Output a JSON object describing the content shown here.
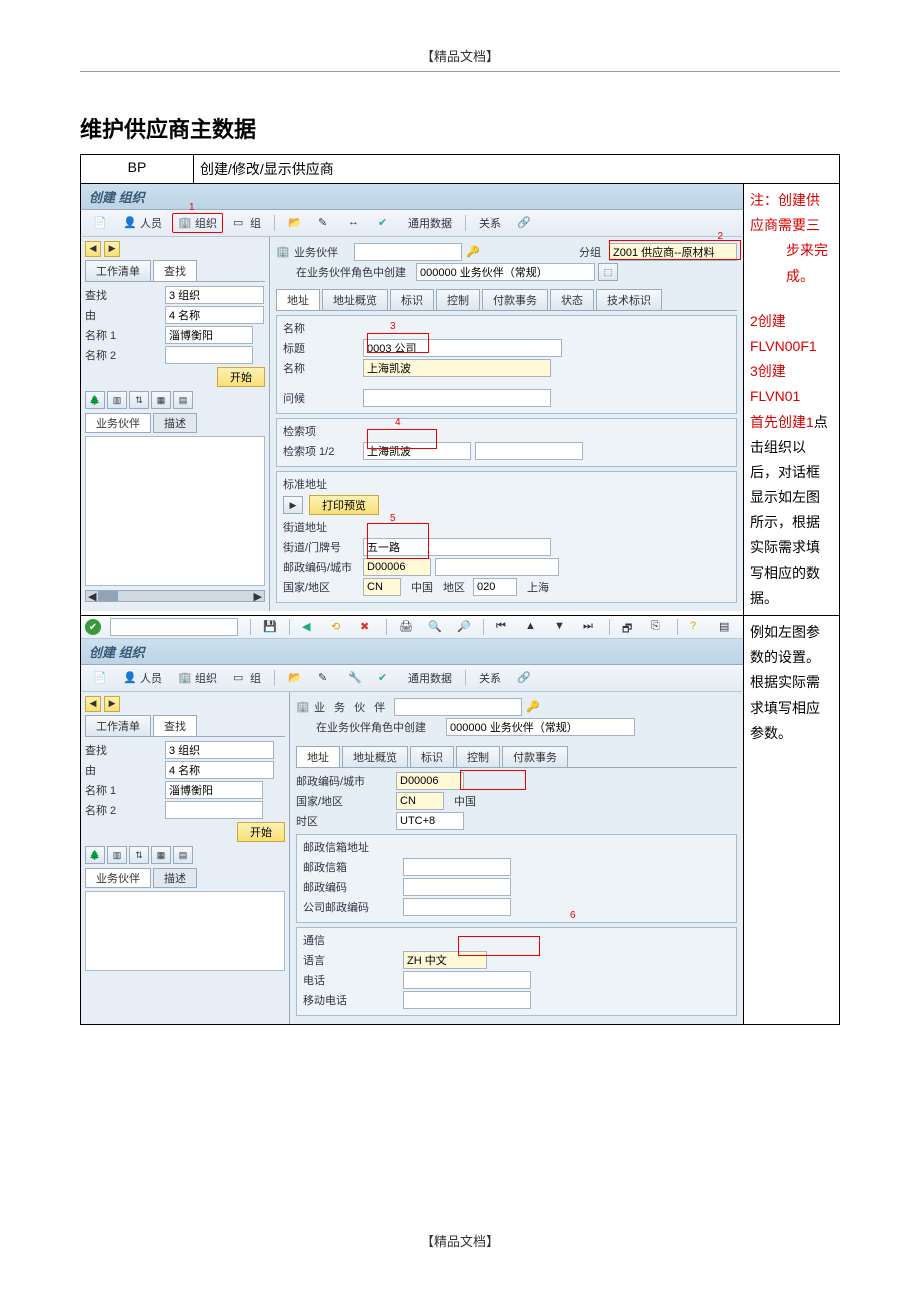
{
  "header_tag": "【精品文档】",
  "footer_tag": "【精品文档】",
  "doc_title": "维护供应商主数据",
  "tcode": "BP",
  "tcode_desc": "创建/修改/显示供应商",
  "screenshot1": {
    "title": "创建 组织",
    "toolbar": {
      "person": "人员",
      "org": "组织",
      "group": "组",
      "general": "通用数据",
      "relation": "关系"
    },
    "annotations": {
      "1": "1",
      "2": "2",
      "3": "3",
      "4": "4",
      "5": "5"
    },
    "left": {
      "arrow_left": "◀",
      "arrow_right": "▶",
      "tab1": "工作清单",
      "tab2": "查找",
      "fields": {
        "search_label": "查找",
        "search_value": "3 组织",
        "by_label": "由",
        "by_value": "4 名称",
        "name1_label": "名称 1",
        "name1_value": "淄博衡阳",
        "name2_label": "名称 2",
        "name2_value": ""
      },
      "start_btn": "开始",
      "bottom_tab1": "业务伙伴",
      "bottom_tab2": "描述"
    },
    "right": {
      "bp_label": "业务伙伴",
      "bp_value": "",
      "role_label": "在业务伙伴角色中创建",
      "role_value": "000000 业务伙伴（常规）",
      "group_label": "分组",
      "group_value": "Z001 供应商--原材料",
      "tabs": [
        "地址",
        "地址概览",
        "标识",
        "控制",
        "付款事务",
        "状态",
        "技术标识"
      ],
      "sec_name_title": "名称",
      "title_label": "标题",
      "title_value": "0003 公司",
      "name_label": "名称",
      "name_value": "上海凯波",
      "q_label": "问候",
      "q_value": "",
      "sec_search_title": "检索项",
      "search12_label": "检索项 1/2",
      "search12_value": "上海凯波",
      "sec_addr_title": "标准地址",
      "print_btn": "打印预览",
      "street_title": "街道地址",
      "street_label": "街道/门牌号",
      "street_value": "五一路",
      "zip_label": "邮政编码/城市",
      "zip_value": "D00006",
      "country_label": "国家/地区",
      "country_value": "CN",
      "country_text": "中国",
      "region_label": "地区",
      "region_value": "020",
      "region_text": "上海"
    }
  },
  "screenshot2": {
    "title": "创建 组织",
    "annotations": {
      "6": "6"
    },
    "toolbar": {
      "person": "人员",
      "org": "组织",
      "group": "组",
      "general": "通用数据",
      "relation": "关系"
    },
    "left": {
      "tab1": "工作清单",
      "tab2": "查找",
      "fields": {
        "search_label": "查找",
        "search_value": "3 组织",
        "by_label": "由",
        "by_value": "4 名称",
        "name1_label": "名称 1",
        "name1_value": "淄博衡阳",
        "name2_label": "名称 2",
        "name2_value": ""
      },
      "start_btn": "开始",
      "bottom_tab1": "业务伙伴",
      "bottom_tab2": "描述"
    },
    "right": {
      "bp_label": "业 务 伙 伴",
      "role_label": "在业务伙伴角色中创建",
      "role_value": "000000 业务伙伴（常规）",
      "tabs": [
        "地址",
        "地址概览",
        "标识",
        "控制",
        "付款事务"
      ],
      "zip_label": "邮政编码/城市",
      "zip_value": "D00006",
      "country_label": "国家/地区",
      "country_value": "CN",
      "country_text": "中国",
      "tz_label": "时区",
      "tz_value": "UTC+8",
      "pobox_title": "邮政信箱地址",
      "pobox_label": "邮政信箱",
      "pobox_value": "",
      "pozip_label": "邮政编码",
      "pozip_value": "",
      "cozip_label": "公司邮政编码",
      "cozip_value": "",
      "comm_title": "通信",
      "lang_label": "语言",
      "lang_value": "ZH 中文",
      "phone_label": "电话",
      "phone_value": "",
      "mobile_label": "移动电话",
      "mobile_value": ""
    }
  },
  "side1": {
    "note_prefix": "注：",
    "note_body1": "创建供应商需要三",
    "note_body2": "步来完成。",
    "step2": "2创建FLVN00F1",
    "step3": "3创建FLVN01",
    "first_prefix": "首先创建1",
    "first_rest1": "点击组织以",
    "rest_l1": "后，对话框显示如左图",
    "rest_l2": "所示，根据实际需求填",
    "rest_l3": "写相应的数据。"
  },
  "side2": {
    "l1": "例如左图参数的设置。",
    "l2": "根据实际需求填写相应",
    "l3": "参数。"
  }
}
